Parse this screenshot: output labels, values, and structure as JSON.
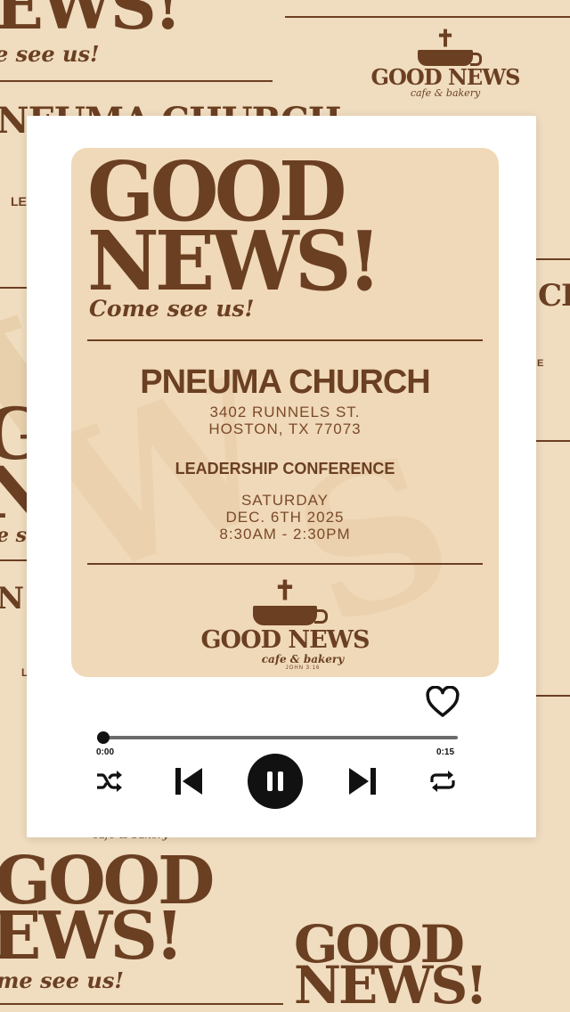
{
  "background": {
    "top_headline": "EWS!",
    "top_tagline": "e see us!",
    "top_rule_text": "NEUMA CHURCH",
    "left_fragments": [
      "LE",
      "GO",
      "NE",
      "e s",
      "N",
      "L"
    ],
    "right_fragments": [
      "CH",
      "E"
    ],
    "bottom_left_headline_1": "GOOD",
    "bottom_left_headline_2": "EWS!",
    "bottom_left_tagline": "me see us!",
    "bottom_right_headline_1": "GOOD",
    "bottom_right_headline_2": "NEWS!",
    "bottom_mid_fragment": "cafe & bakery",
    "logo": {
      "word": "GOOD NEWS",
      "sub": "cafe & bakery"
    }
  },
  "poster": {
    "headline_line1": "GOOD",
    "headline_line2": "NEWS!",
    "tagline": "Come see us!",
    "venue": "PNEUMA CHURCH",
    "address_line1": "3402 RUNNELS ST.",
    "address_line2": "HOSTON, TX 77073",
    "event": "LEADERSHIP CONFERENCE",
    "day": "SATURDAY",
    "date": "DEC. 6TH 2025",
    "time": "8:30AM - 2:30PM",
    "logo_word": "GOOD NEWS",
    "logo_sub": "cafe & bakery",
    "logo_verse": "JOHN 3:16"
  },
  "player": {
    "elapsed": "0:00",
    "duration": "0:15",
    "progress": 0.0,
    "state": "playing",
    "icons": [
      "heart-icon",
      "shuffle-icon",
      "previous-icon",
      "pause-icon",
      "next-icon",
      "repeat-icon"
    ]
  },
  "colors": {
    "brown": "#6b3f22",
    "paper": "#f0d9b8",
    "control": "#111111"
  }
}
